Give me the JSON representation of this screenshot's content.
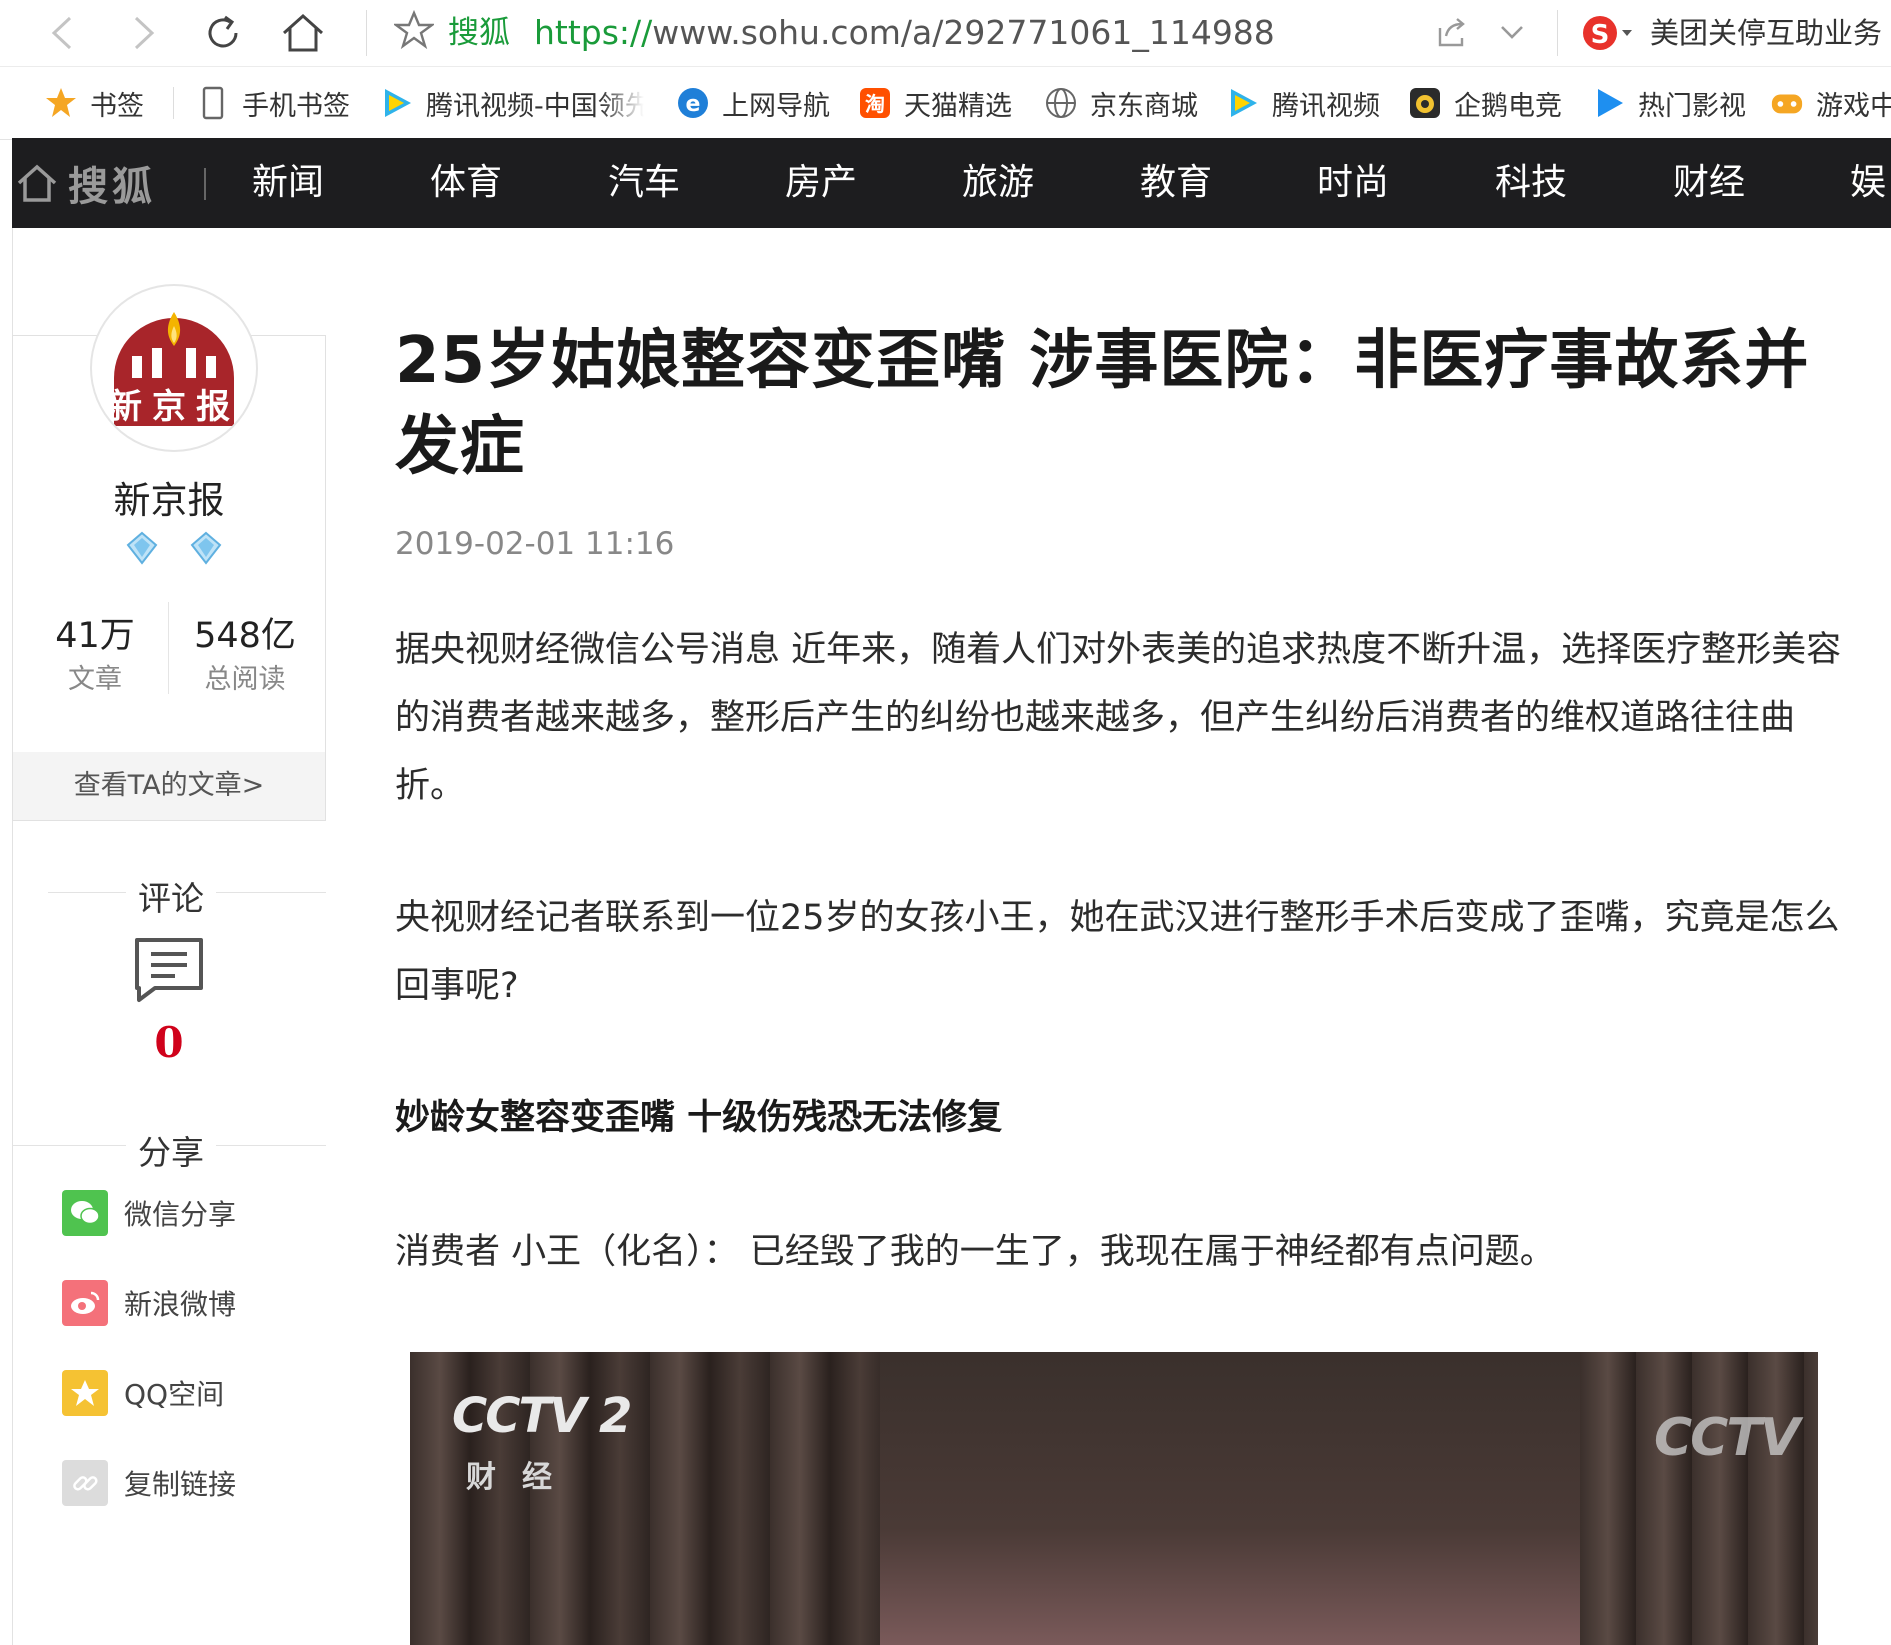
{
  "browser": {
    "site_name": "搜狐",
    "url_scheme": "https://",
    "url_rest": "www.sohu.com/a/292771061_114988",
    "search_hint": "美团关停互助业务"
  },
  "bookmarks": [
    {
      "label": "书签",
      "icon": "star-icon"
    },
    {
      "label": "手机书签",
      "icon": "phone-icon"
    },
    {
      "label": "腾讯视频-中国领先",
      "icon": "tencent-video-icon"
    },
    {
      "label": "上网导航",
      "icon": "ie-icon"
    },
    {
      "label": "天猫精选",
      "icon": "taobao-icon"
    },
    {
      "label": "京东商城",
      "icon": "globe-icon"
    },
    {
      "label": "腾讯视频",
      "icon": "tencent-video-icon"
    },
    {
      "label": "企鹅电竞",
      "icon": "penguin-icon"
    },
    {
      "label": "热门影视",
      "icon": "play-icon"
    },
    {
      "label": "游戏中",
      "icon": "gamepad-icon"
    }
  ],
  "nav": {
    "logo": "搜狐",
    "items": [
      "新闻",
      "体育",
      "汽车",
      "房产",
      "旅游",
      "教育",
      "时尚",
      "科技",
      "财经",
      "娱"
    ]
  },
  "author": {
    "logo_text": "新京报",
    "name": "新京报",
    "articles": "41万",
    "articles_label": "文章",
    "reads": "548亿",
    "reads_label": "总阅读",
    "link": "查看TA的文章>"
  },
  "comments": {
    "title": "评论",
    "count": "0"
  },
  "share": {
    "title": "分享",
    "items": [
      {
        "label": "微信分享",
        "color": "#4fc34f",
        "icon": "wechat-icon"
      },
      {
        "label": "新浪微博",
        "color": "#f4717a",
        "icon": "weibo-icon"
      },
      {
        "label": "QQ空间",
        "color": "#f5c233",
        "icon": "qzone-icon"
      },
      {
        "label": "复制链接",
        "color": "#dcdcdc",
        "icon": "link-icon"
      }
    ]
  },
  "article": {
    "title": "25岁姑娘整容变歪嘴 涉事医院：非医疗事故系并发症",
    "date": "2019-02-01 11:16",
    "paragraphs": [
      "据央视财经微信公号消息 近年来，随着人们对外表美的追求热度不断升温，选择医疗整形美容的消费者越来越多，整形后产生的纠纷也越来越多，但产生纠纷后消费者的维权道路往往曲折。",
      "央视财经记者联系到一位25岁的女孩小王，她在武汉进行整形手术后变成了歪嘴，究竟是怎么回事呢?",
      "妙龄女整容变歪嘴 十级伤残恐无法修复",
      "消费者 小王（化名）：  已经毁了我的一生了，我现在属于神经都有点问题。"
    ],
    "video": {
      "logo": "CCTV 2",
      "channel": "财经",
      "watermark": "CCTV"
    }
  },
  "colors": {
    "nav_bg": "#1d1d1f",
    "accent_red": "#d0021b",
    "url_green": "#1a9b3a"
  }
}
